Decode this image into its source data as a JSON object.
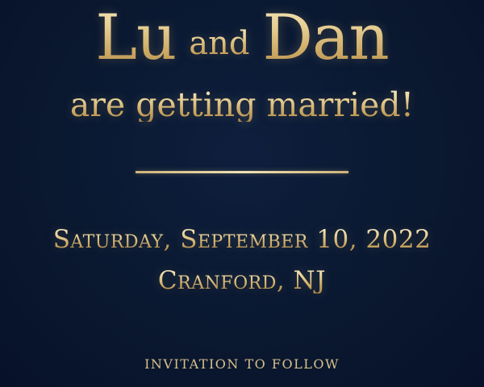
{
  "colors": {
    "background": "#0a1830",
    "gold": "#d8c08a"
  },
  "header": {
    "name1": "Lu",
    "conjunction": "and",
    "name2": "Dan",
    "subtitle": "are getting married!"
  },
  "details": {
    "date": "Saturday, September 10, 2022",
    "location": "Cranford, NJ"
  },
  "footer": {
    "note": "INVITATION TO FOLLOW"
  }
}
